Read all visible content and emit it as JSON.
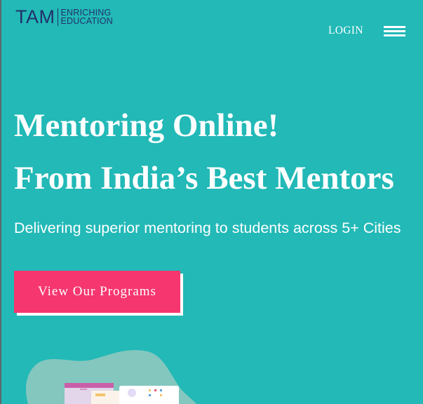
{
  "header": {
    "logo": {
      "mark": "TAM",
      "line1": "ENRICHING",
      "line2": "EDUCATION"
    },
    "login_label": "LOGIN",
    "menu_icon": "hamburger-menu-icon"
  },
  "hero": {
    "headline_line1": "Mentoring Online!",
    "headline_line2": "From India’s Best Mentors",
    "subtitle": "Delivering superior mentoring to students across 5+ Cities",
    "cta_label": "View Our Programs"
  },
  "colors": {
    "background": "#22b9b7",
    "brand_navy": "#23306b",
    "cta_pink": "#f6366f",
    "text_white": "#ffffff"
  }
}
